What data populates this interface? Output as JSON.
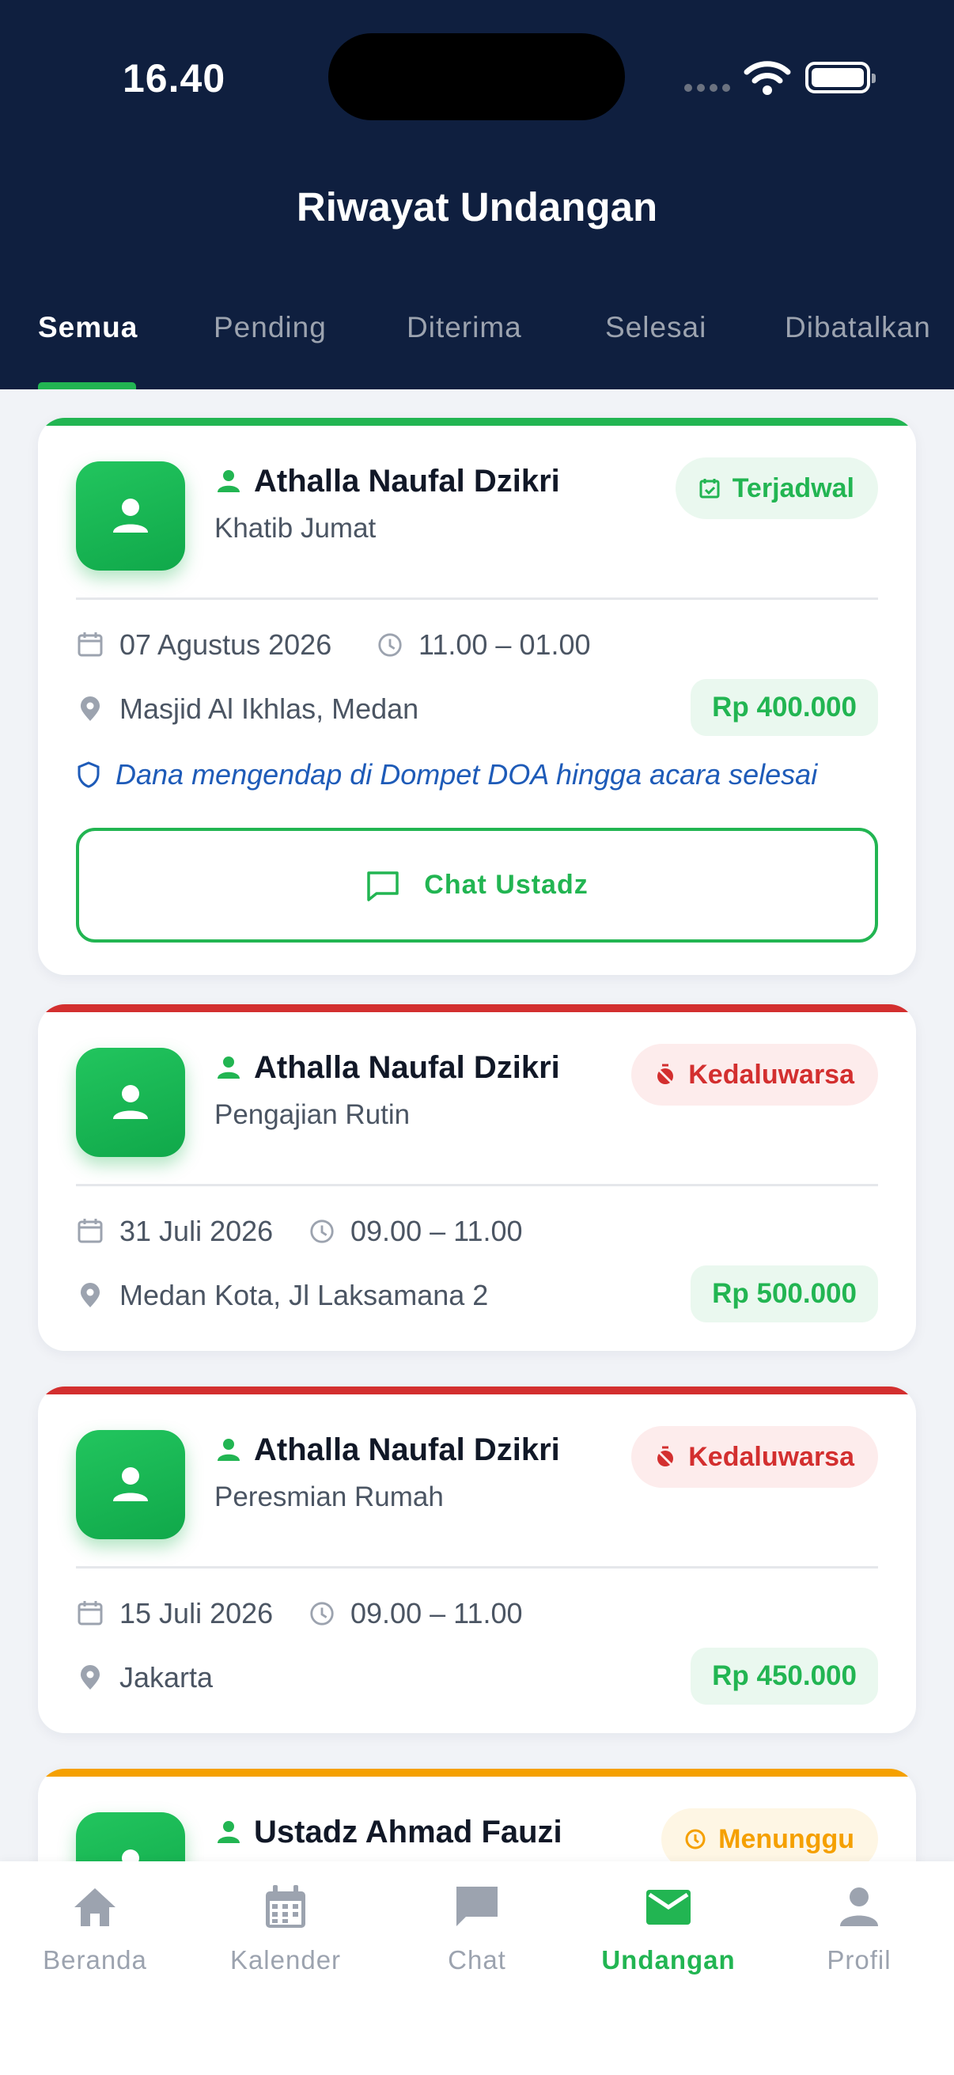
{
  "status_bar": {
    "time": "16.40"
  },
  "header": {
    "title": "Riwayat Undangan"
  },
  "tabs": [
    {
      "label": "Semua",
      "active": true
    },
    {
      "label": "Pending",
      "active": false
    },
    {
      "label": "Diterima",
      "active": false
    },
    {
      "label": "Selesai",
      "active": false
    },
    {
      "label": "Dibatalkan",
      "active": false
    }
  ],
  "colors": {
    "header_bg": "#0F1F3F",
    "primary_green": "#22B552",
    "expired_red": "#D32F2F",
    "pending_orange": "#F5A000",
    "escrow_blue": "#1E5BB8"
  },
  "invitations": [
    {
      "name": "Athalla Naufal Dzikri",
      "event": "Khatib Jumat",
      "status": "Terjadwal",
      "status_icon": "calendar-check-icon",
      "date": "07 Agustus 2026",
      "time": "11.00 – 01.00",
      "location": "Masjid Al Ikhlas, Medan",
      "price": "Rp 400.000",
      "escrow_note": "Dana mengendap di Dompet DOA hingga acara selesai",
      "action": "Chat Ustadz"
    },
    {
      "name": "Athalla Naufal Dzikri",
      "event": "Pengajian Rutin",
      "status": "Kedaluwarsa",
      "status_icon": "timer-off-icon",
      "date": "31 Juli 2026",
      "time": "09.00 – 11.00",
      "location": "Medan Kota, Jl Laksamana 2",
      "price": "Rp 500.000"
    },
    {
      "name": "Athalla Naufal Dzikri",
      "event": "Peresmian Rumah",
      "status": "Kedaluwarsa",
      "status_icon": "timer-off-icon",
      "date": "15 Juli 2026",
      "time": "09.00 – 11.00",
      "location": "Jakarta",
      "price": "Rp 450.000"
    },
    {
      "name": "Ustadz Ahmad Fauzi",
      "status": "Menunggu",
      "status_icon": "clock-icon"
    }
  ],
  "bottom_nav": [
    {
      "label": "Beranda",
      "icon": "home-icon",
      "active": false
    },
    {
      "label": "Kalender",
      "icon": "calendar-icon",
      "active": false
    },
    {
      "label": "Chat",
      "icon": "chat-icon",
      "active": false
    },
    {
      "label": "Undangan",
      "icon": "mail-icon",
      "active": true
    },
    {
      "label": "Profil",
      "icon": "person-icon",
      "active": false
    }
  ]
}
